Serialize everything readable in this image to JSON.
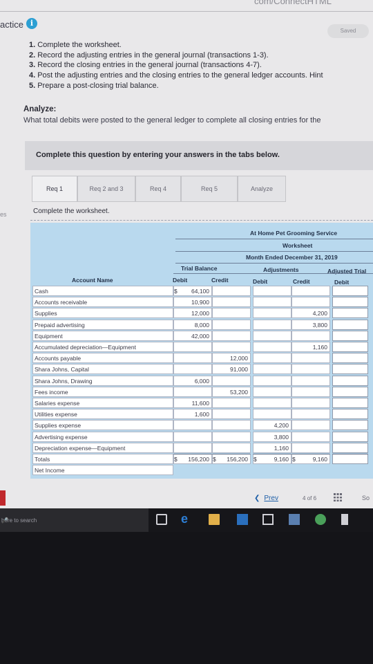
{
  "header": {
    "practice_label": "actice",
    "info_icon_glyph": "i",
    "saved_label": "Saved",
    "url_fragment": "com/ConnectHTML"
  },
  "tasks": [
    {
      "num": "1.",
      "text": "Complete the worksheet."
    },
    {
      "num": "2.",
      "text": "Record the adjusting entries in the general journal (transactions 1-3)."
    },
    {
      "num": "3.",
      "text": "Record the closing entries in the general journal (transactions 4-7)."
    },
    {
      "num": "4.",
      "text": "Post the adjusting entries and the closing entries to the general ledger accounts. Hint"
    },
    {
      "num": "5.",
      "text": "Prepare a post-closing trial balance."
    }
  ],
  "analyze": {
    "heading": "Analyze:",
    "question": "What total debits were posted to the general ledger to complete all closing entries for the"
  },
  "instruction": "Complete this question by entering your answers in the tabs below.",
  "tabs": [
    {
      "label": "Req 1",
      "active": true
    },
    {
      "label": "Req 2 and 3",
      "active": false
    },
    {
      "label": "Req 4",
      "active": false
    },
    {
      "label": "Req 5",
      "active": false
    },
    {
      "label": "Analyze",
      "active": false
    }
  ],
  "side_fragment": "es",
  "subquestion": "Complete the worksheet.",
  "worksheet": {
    "company": "At Home Pet Grooming Service",
    "title": "Worksheet",
    "period": "Month Ended December 31, 2019",
    "groups": {
      "trial_balance": "Trial Balance",
      "adjustments": "Adjustments",
      "adjusted_trial": "Adjusted Trial"
    },
    "columns": {
      "account_name": "Account Name",
      "tb_debit": "Debit",
      "tb_credit": "Credit",
      "adj_debit": "Debit",
      "adj_credit": "Credit",
      "atb_debit": "Debit"
    },
    "rows": [
      {
        "name": "Cash",
        "tb_dr": "64,100",
        "tb_cr": "",
        "adj_dr": "",
        "adj_cr": ""
      },
      {
        "name": "Accounts receivable",
        "tb_dr": "10,900",
        "tb_cr": "",
        "adj_dr": "",
        "adj_cr": ""
      },
      {
        "name": "Supplies",
        "tb_dr": "12,000",
        "tb_cr": "",
        "adj_dr": "",
        "adj_cr": "4,200"
      },
      {
        "name": "Prepaid advertising",
        "tb_dr": "8,000",
        "tb_cr": "",
        "adj_dr": "",
        "adj_cr": "3,800"
      },
      {
        "name": "Equipment",
        "tb_dr": "42,000",
        "tb_cr": "",
        "adj_dr": "",
        "adj_cr": ""
      },
      {
        "name": "Accumulated depreciation—Equipment",
        "tb_dr": "",
        "tb_cr": "",
        "adj_dr": "",
        "adj_cr": "1,160"
      },
      {
        "name": "Accounts payable",
        "tb_dr": "",
        "tb_cr": "12,000",
        "adj_dr": "",
        "adj_cr": ""
      },
      {
        "name": "Shara Johns, Capital",
        "tb_dr": "",
        "tb_cr": "91,000",
        "adj_dr": "",
        "adj_cr": ""
      },
      {
        "name": "Shara Johns, Drawing",
        "tb_dr": "6,000",
        "tb_cr": "",
        "adj_dr": "",
        "adj_cr": ""
      },
      {
        "name": "Fees income",
        "tb_dr": "",
        "tb_cr": "53,200",
        "adj_dr": "",
        "adj_cr": ""
      },
      {
        "name": "Salaries expense",
        "tb_dr": "11,600",
        "tb_cr": "",
        "adj_dr": "",
        "adj_cr": ""
      },
      {
        "name": "Utilities expense",
        "tb_dr": "1,600",
        "tb_cr": "",
        "adj_dr": "",
        "adj_cr": ""
      },
      {
        "name": "Supplies expense",
        "tb_dr": "",
        "tb_cr": "",
        "adj_dr": "4,200",
        "adj_cr": ""
      },
      {
        "name": "Advertising expense",
        "tb_dr": "",
        "tb_cr": "",
        "adj_dr": "3,800",
        "adj_cr": ""
      },
      {
        "name": "Depreciation expense—Equipment",
        "tb_dr": "",
        "tb_cr": "",
        "adj_dr": "1,160",
        "adj_cr": ""
      }
    ],
    "cash_symbol": "$",
    "totals": {
      "name": "Totals",
      "tb_dr": "156,200",
      "tb_cr": "156,200",
      "adj_dr": "9,160",
      "adj_cr": "9,160",
      "symbol": "$"
    },
    "net_income_label": "Net Income"
  },
  "navigation": {
    "prev_label": "Prev",
    "prev_icon": "chevron-left-icon",
    "page_current": "4",
    "page_of": "of",
    "page_total": "6",
    "next_fragment": "So"
  },
  "taskbar": {
    "search_placeholder": "here to search",
    "mic_icon": "microphone-icon",
    "apps": [
      "task-view-icon",
      "edge-icon",
      "file-explorer-icon",
      "store-icon",
      "chrome-icon",
      "window-icon",
      "app-icon",
      "photos-icon",
      "media-icon"
    ]
  },
  "colors": {
    "accent": "#2c9fd3",
    "sheet_bg": "#b9d9ee",
    "link": "#1e5fa8",
    "alert_red": "#c0282c"
  }
}
